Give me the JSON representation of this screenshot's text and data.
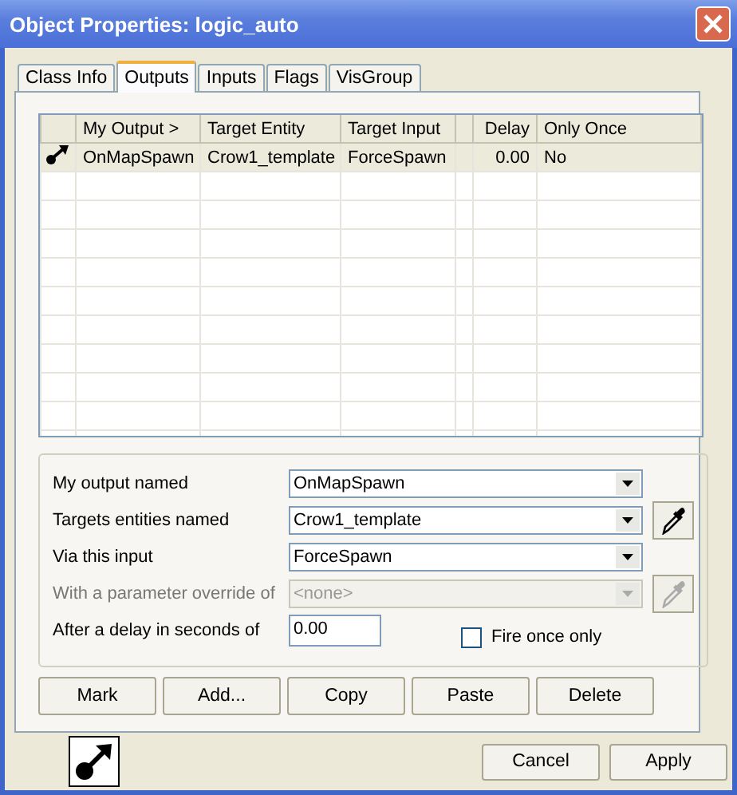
{
  "window": {
    "title": "Object Properties: logic_auto"
  },
  "tabs": [
    {
      "label": "Class Info",
      "selected": false
    },
    {
      "label": "Outputs",
      "selected": true
    },
    {
      "label": "Inputs",
      "selected": false
    },
    {
      "label": "Flags",
      "selected": false
    },
    {
      "label": "VisGroup",
      "selected": false
    }
  ],
  "table": {
    "columns": [
      "My Output >",
      "Target Entity",
      "Target Input",
      "Delay",
      "Only Once"
    ],
    "rows": [
      {
        "selected": true,
        "cells": [
          "OnMapSpawn",
          "Crow1_template",
          "ForceSpawn",
          "0.00",
          "No"
        ]
      }
    ]
  },
  "form": {
    "fields": [
      {
        "label": "My output named",
        "kind": "combo",
        "value": "OnMapSpawn",
        "disabled": false,
        "picker": false
      },
      {
        "label": "Targets entities named",
        "kind": "combo",
        "value": "Crow1_template",
        "disabled": false,
        "picker": true
      },
      {
        "label": "Via this input",
        "kind": "combo",
        "value": "ForceSpawn",
        "disabled": false,
        "picker": false
      },
      {
        "label": "With a parameter override of",
        "kind": "combo",
        "value": "<none>",
        "disabled": true,
        "picker": true
      },
      {
        "label": "After a delay in seconds of",
        "kind": "text",
        "value": "0.00",
        "disabled": false,
        "picker": false
      }
    ],
    "checkbox": {
      "label": "Fire once only",
      "checked": false
    }
  },
  "buttons": [
    "Mark",
    "Add...",
    "Copy",
    "Paste",
    "Delete"
  ],
  "footer_buttons": [
    "Cancel",
    "Apply"
  ]
}
